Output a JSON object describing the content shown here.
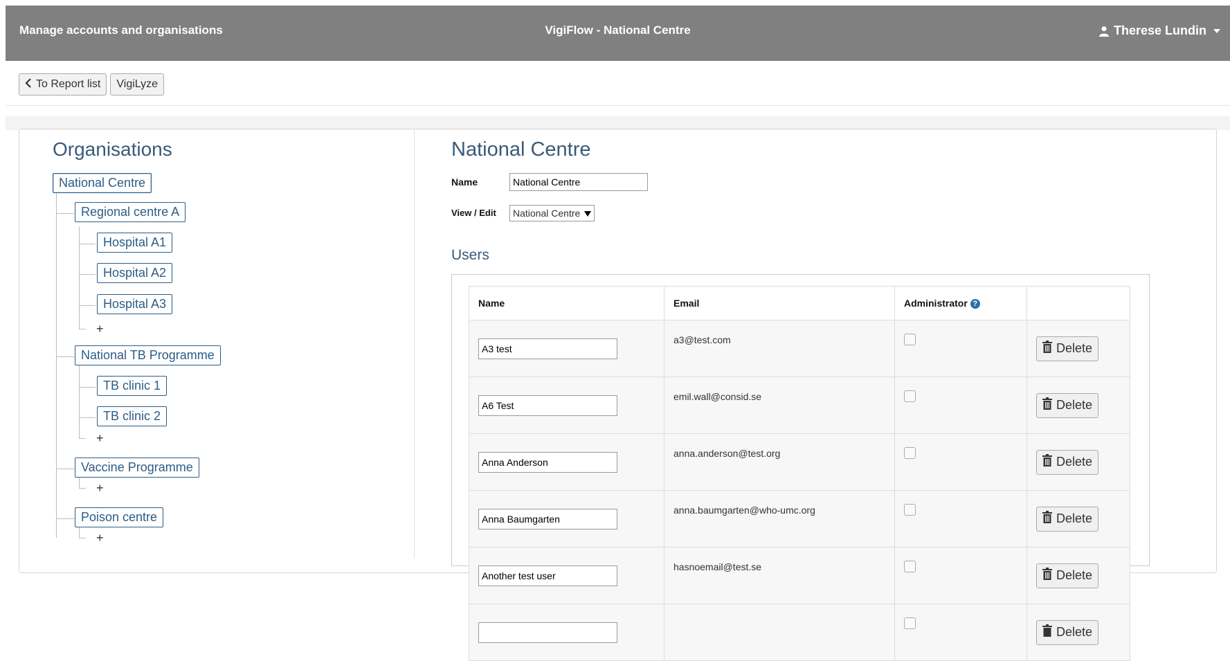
{
  "header": {
    "left_title": "Manage accounts and organisations",
    "center_title": "VigiFlow -  National Centre",
    "user_name": "Therese Lundin"
  },
  "nav": {
    "back_label": "To Report list",
    "vigilyze_label": "VigiLyze"
  },
  "organisations": {
    "title": "Organisations",
    "add_symbol": "+",
    "root": "National Centre",
    "regional_centre": "Regional centre A",
    "hospital_a1": "Hospital A1",
    "hospital_a2": "Hospital A2",
    "hospital_a3": "Hospital A3",
    "tb_programme": "National TB Programme",
    "tb_clinic_1": "TB clinic 1",
    "tb_clinic_2": "TB clinic 2",
    "vaccine_programme": "Vaccine Programme",
    "poison_centre": "Poison centre"
  },
  "details": {
    "title": "National Centre",
    "name_label": "Name",
    "name_value": "National Centre",
    "view_edit_label": "View / Edit",
    "view_edit_value": "National Centre",
    "users_title": "Users"
  },
  "users_table": {
    "col_name": "Name",
    "col_email": "Email",
    "col_admin": "Administrator",
    "delete_label": "Delete",
    "rows": [
      {
        "name": "A3 test",
        "email": "a3@test.com"
      },
      {
        "name": "A6 Test",
        "email": "emil.wall@consid.se"
      },
      {
        "name": "Anna Anderson",
        "email": "anna.anderson@test.org"
      },
      {
        "name": "Anna Baumgarten",
        "email": "anna.baumgarten@who-umc.org"
      },
      {
        "name": "Another test user",
        "email": "hasnoemail@test.se"
      }
    ]
  },
  "colors": {
    "topbar": "#808080",
    "accent": "#2c5c86",
    "help_icon": "#2c6fa5"
  }
}
